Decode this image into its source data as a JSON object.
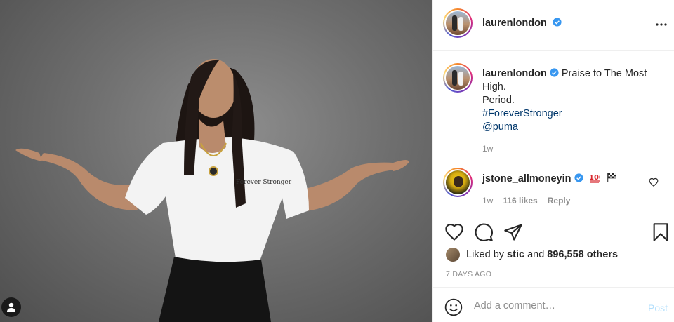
{
  "post": {
    "author": "laurenlondon",
    "caption": {
      "username": "laurenlondon",
      "line1": "Praise to The Most",
      "line2": "High.",
      "line3": "Period.",
      "hashtag": "#ForeverStronger",
      "mention": "@puma",
      "time": "1w"
    },
    "comment": {
      "username": "jstone_allmoneyin",
      "time": "1w",
      "likes": "116 likes",
      "reply": "Reply"
    },
    "likes": {
      "prefix": "Liked by ",
      "user": "stic",
      "middle": " and ",
      "count": "896,558 others"
    },
    "posted_ago": "7 DAYS AGO",
    "add_comment": {
      "placeholder": "Add a comment…",
      "post_label": "Post"
    },
    "shirt_text": "Forever Stronger"
  },
  "icons": {
    "header": [
      "verified-icon",
      "more-icon"
    ],
    "actions": [
      "heart-icon",
      "comment-icon",
      "share-icon",
      "bookmark-icon"
    ],
    "composer": [
      "smile-icon"
    ],
    "photo": [
      "user-tag-icon"
    ]
  },
  "colors": {
    "link": "#00376b",
    "verified": "#3897f0",
    "post_disabled": "#b2dffc",
    "muted": "#8e8e8e"
  }
}
